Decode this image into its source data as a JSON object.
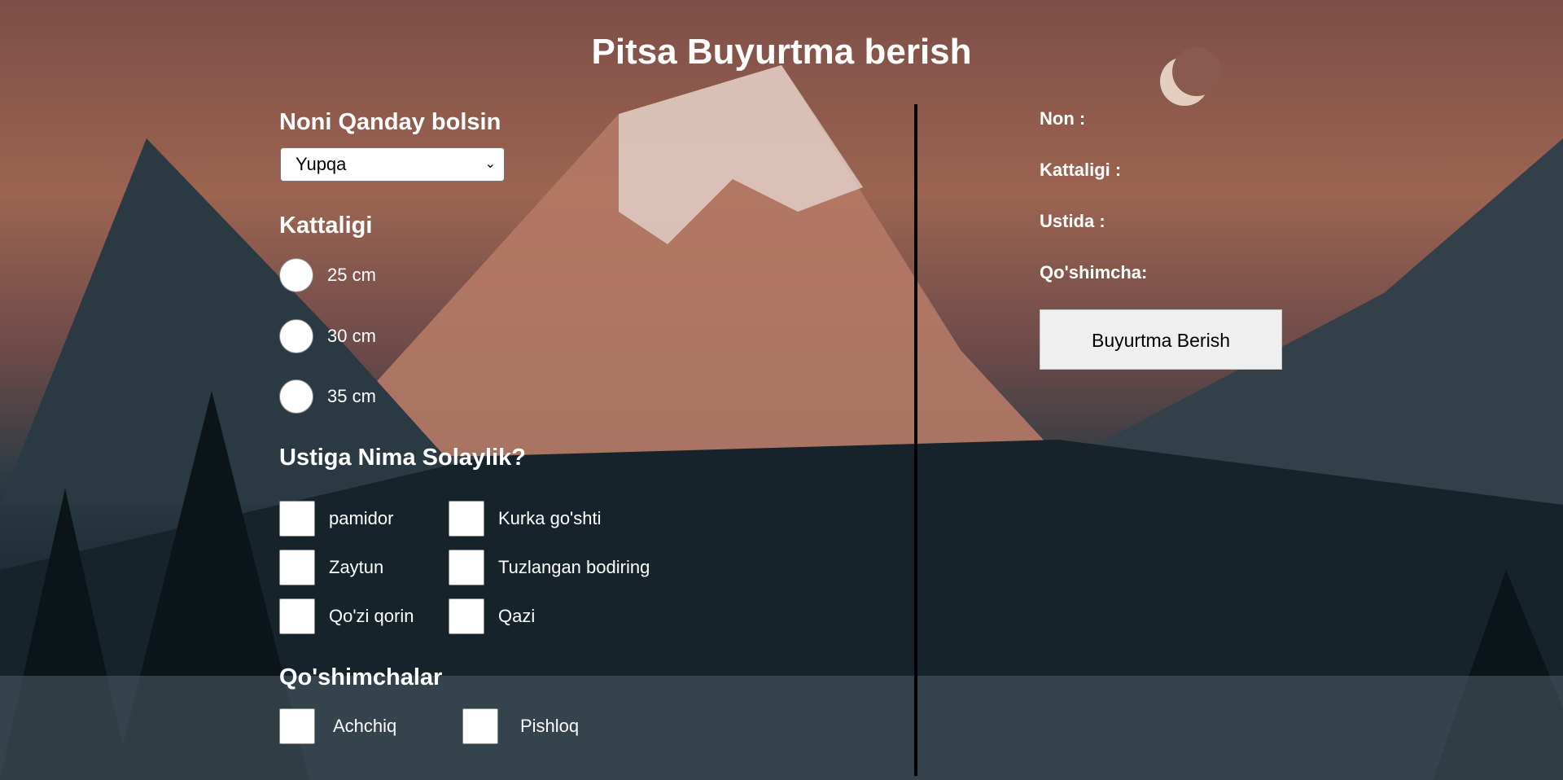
{
  "page": {
    "title": "Pitsa Buyurtma berish"
  },
  "form": {
    "crust": {
      "heading": "Noni Qanday bolsin",
      "selected": "Yupqa"
    },
    "size": {
      "heading": "Kattaligi",
      "options": [
        "25 cm",
        "30 cm",
        "35 cm"
      ]
    },
    "toppings": {
      "heading": "Ustiga Nima Solaylik?",
      "options": [
        "pamidor",
        "Kurka go'shti",
        "Zaytun",
        "Tuzlangan bodiring",
        "Qo'zi qorin",
        "Qazi"
      ]
    },
    "extras": {
      "heading": "Qo'shimchalar",
      "options": [
        "Achchiq",
        "Pishloq"
      ]
    }
  },
  "summary": {
    "crust_label": "Non :",
    "size_label": "Kattaligi :",
    "toppings_label": "Ustida :",
    "extras_label": "Qo'shimcha:",
    "order_button": "Buyurtma Berish"
  },
  "colors": {
    "text": "#ffffff",
    "divider": "#000000",
    "button_bg": "#efefef"
  }
}
